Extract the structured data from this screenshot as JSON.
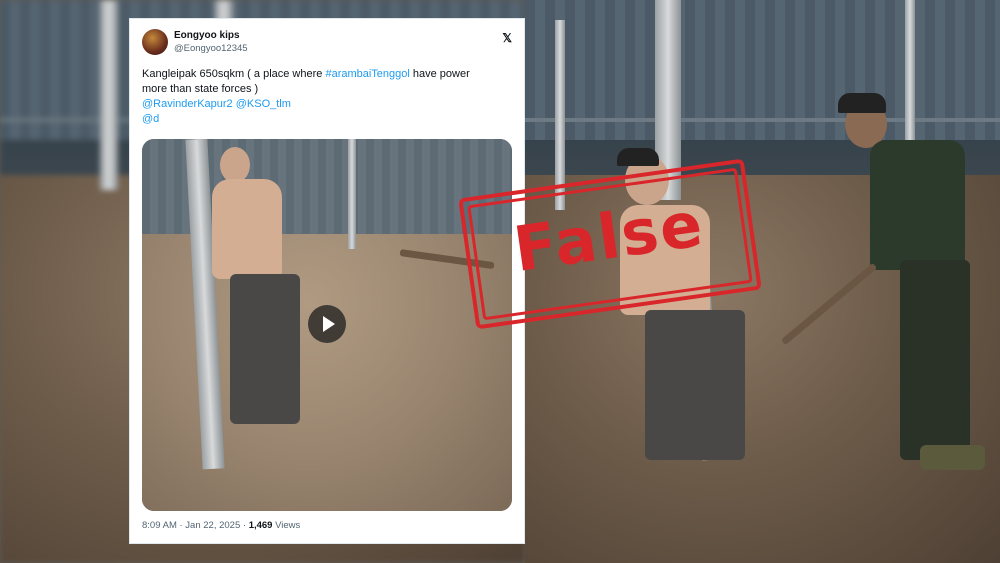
{
  "tweet": {
    "display_name": "Eongyoo kips",
    "handle": "@Eongyoo12345",
    "text_line1": "Kangleipak 650sqkm ( a place where ",
    "hashtag": "#arambaiTenggol",
    "text_line1_end": " have power",
    "text_line2": "more than state forces )",
    "mention1": "@RavinderKapur2",
    "mention2": "@KSO_tlm",
    "mention3": "@d",
    "time": "8:09 AM · Jan 22, 2025 · ",
    "views_count": "1,469",
    "views_label": " Views"
  },
  "stamp": {
    "label": "False",
    "color": "#d9262b"
  },
  "icons": {
    "brand": "x-logo-icon",
    "video_control": "play-icon"
  }
}
